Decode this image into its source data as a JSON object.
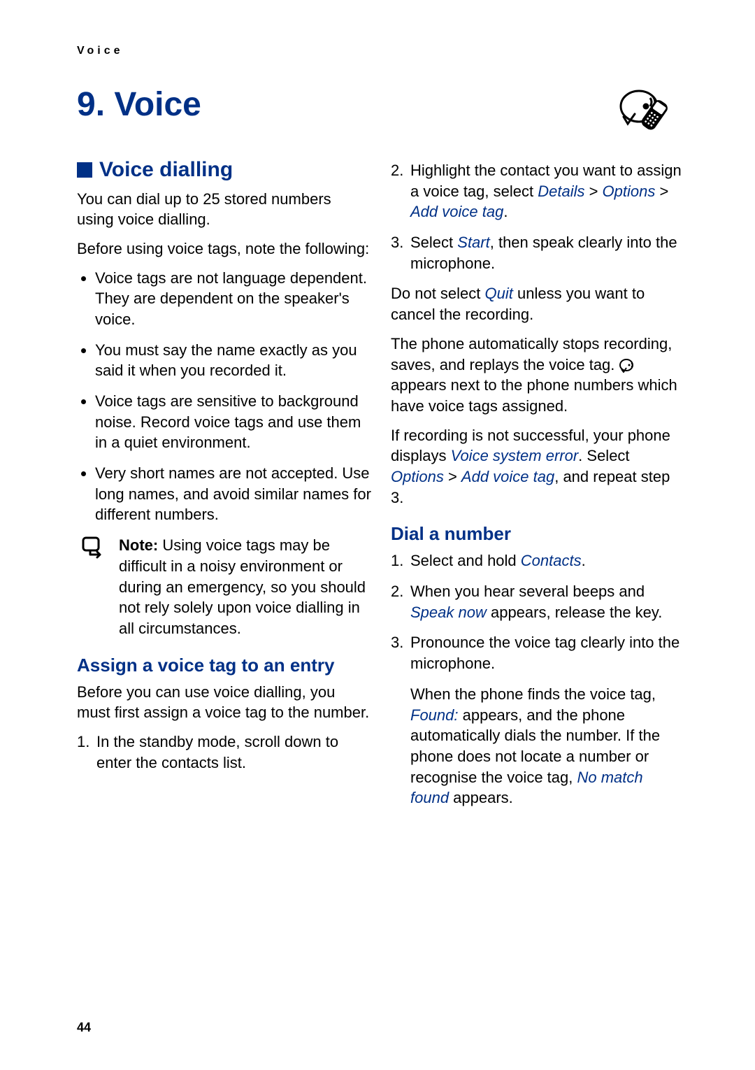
{
  "runningHead": "Voice",
  "chapterTitle": "9. Voice",
  "pageNumber": "44",
  "left": {
    "section1": {
      "heading": "Voice dialling",
      "p1": "You can dial up to 25 stored numbers using voice dialling.",
      "p2": "Before using voice tags, note the following:",
      "bullets": {
        "b1": "Voice tags are not language dependent. They are dependent on the speaker's voice.",
        "b2": "You must say the name exactly as you said it when you recorded it.",
        "b3": "Voice tags are sensitive to background noise. Record voice tags and use them in a quiet environment.",
        "b4": "Very short names are not accepted. Use long names, and avoid similar names for different numbers."
      },
      "note": {
        "label": "Note:",
        "text": " Using voice tags may be difficult in a noisy environment or during an emergency, so you should not rely solely upon voice dialling in all circumstances."
      }
    },
    "section2": {
      "heading": "Assign a voice tag to an entry",
      "p1": "Before you can use voice dialling, you must first assign a voice tag to the number.",
      "step1": "In the standby mode, scroll down to enter the contacts list."
    }
  },
  "right": {
    "step2_pre": "Highlight the contact you want to assign a voice tag, select ",
    "step2_menu1": "Details",
    "step2_sep": " > ",
    "step2_menu2": "Options",
    "step2_menu3": "Add voice tag",
    "step2_post": ".",
    "step3_pre": "Select ",
    "step3_menu": "Start",
    "step3_post": ", then speak clearly into the microphone.",
    "p_quit_pre": "Do not select ",
    "p_quit_menu": "Quit",
    "p_quit_post": " unless you want to cancel the recording.",
    "p_auto_pre": "The phone automatically stops recording, saves, and replays the voice tag. ",
    "p_auto_post": " appears next to the phone numbers which have voice tags assigned.",
    "p_err_pre": "If recording is not successful, your phone displays ",
    "p_err_menu1": "Voice system error",
    "p_err_mid": ". Select ",
    "p_err_menu2": "Options",
    "p_err_menu3": "Add voice tag",
    "p_err_post": ", and repeat step 3.",
    "sectionDial": {
      "heading": "Dial a number",
      "s1_pre": "Select and hold ",
      "s1_menu": "Contacts",
      "s1_post": ".",
      "s2_pre": "When you hear several beeps and ",
      "s2_menu": "Speak now",
      "s2_post": " appears, release the key.",
      "s3": "Pronounce the voice tag clearly into the microphone.",
      "s3b_pre": "When the phone finds the voice tag, ",
      "s3b_menu1": "Found:",
      "s3b_mid": " appears, and the phone automatically dials the number. If the phone does not locate a number or recognise the voice tag, ",
      "s3b_menu2": "No match found",
      "s3b_post": " appears."
    }
  }
}
